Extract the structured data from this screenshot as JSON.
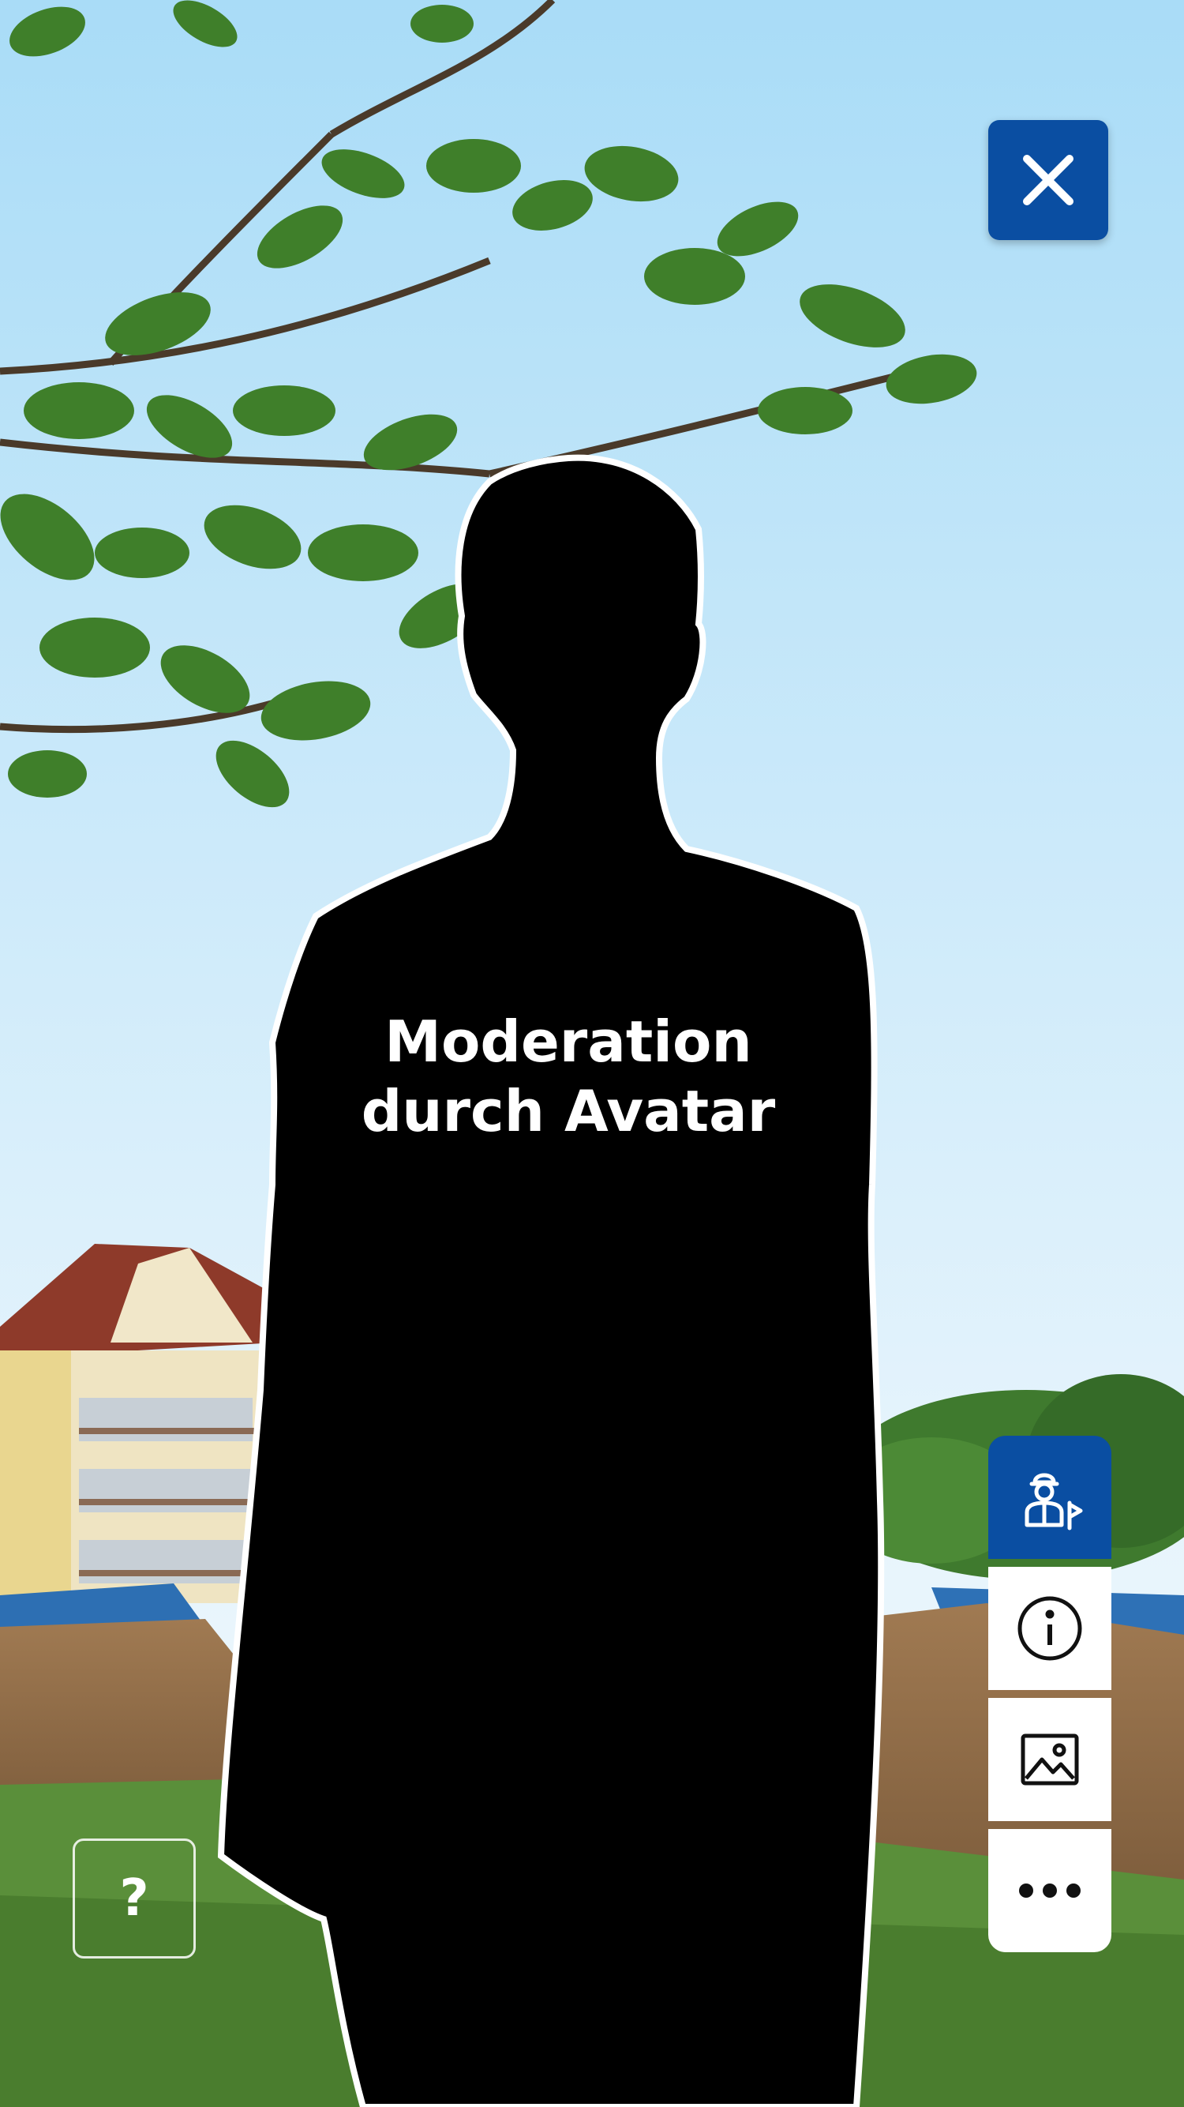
{
  "overlay": {
    "line1": "Moderation",
    "line2": "durch Avatar"
  },
  "buttons": {
    "help_label": "?"
  },
  "toolbar": {
    "items": [
      {
        "icon": "avatar-guide-icon",
        "active": true
      },
      {
        "icon": "info-icon",
        "active": false
      },
      {
        "icon": "image-icon",
        "active": false
      },
      {
        "icon": "more-icon",
        "active": false
      }
    ]
  },
  "colors": {
    "accent": "#0a4ea2",
    "sky_top": "#a9dcf7",
    "sky_bottom": "#eaf6fd"
  }
}
